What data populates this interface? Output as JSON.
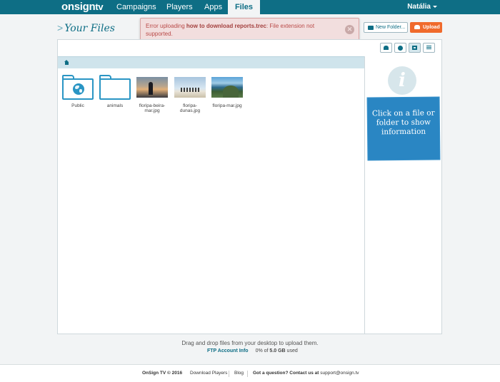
{
  "nav": {
    "logo": "onsign",
    "logo_suffix": "tv",
    "items": [
      "Campaigns",
      "Players",
      "Apps",
      "Files"
    ],
    "active": "Files",
    "user": "Natália"
  },
  "page": {
    "title": "Your Files"
  },
  "error": {
    "prefix": "Error uploading ",
    "filename": "how to download reports.trec",
    "suffix": ": File extension not supported.",
    "close_glyph": "✕"
  },
  "actions": {
    "new_folder": "New Folder...",
    "upload": "Upload"
  },
  "files": [
    {
      "name": "Public",
      "kind": "folder-public"
    },
    {
      "name": "animals",
      "kind": "folder"
    },
    {
      "name": "floripa-beira-mar.jpg",
      "kind": "image"
    },
    {
      "name": "floripa-dunas.jpg",
      "kind": "image"
    },
    {
      "name": "floripa-mar.jpg",
      "kind": "image"
    }
  ],
  "info_panel": {
    "icon": "i",
    "message": "Click on a file or folder to show information"
  },
  "footer_area": {
    "drag_hint": "Drag and drop files from your desktop to upload them.",
    "ftp_link": "FTP Account Info",
    "usage_percent": "0% of ",
    "usage_total": "5.0 GB",
    "usage_suffix": " used"
  },
  "footer": {
    "copyright": "OnSign TV © 2016",
    "download": "Download Players",
    "blog": "Blog",
    "question": "Got a question? Contact us at ",
    "email": "support@onsign.tv"
  },
  "colors": {
    "nav_bg": "#0e6e85",
    "accent": "#2a95c4",
    "upload": "#f06a2c",
    "error_bg": "#f2dede",
    "info_card": "#2a86c3"
  }
}
